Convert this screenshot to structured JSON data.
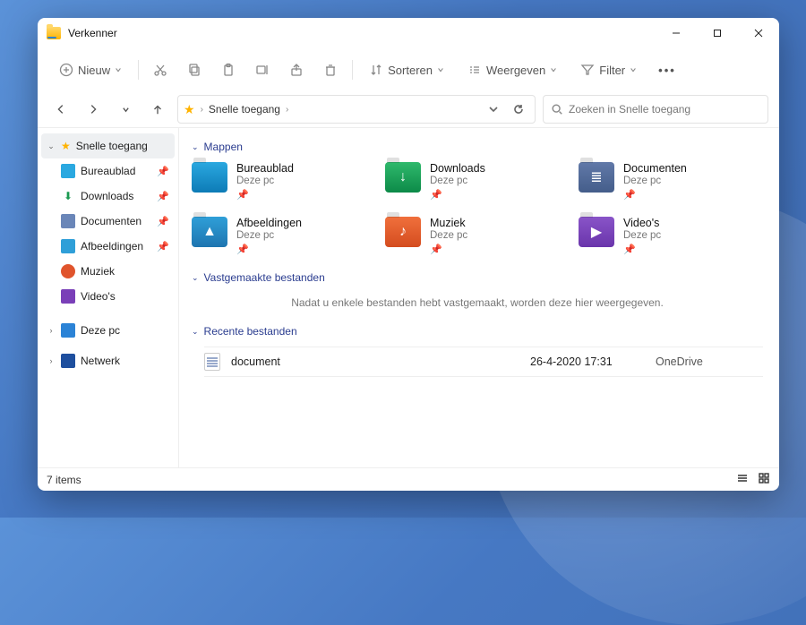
{
  "window": {
    "title": "Verkenner"
  },
  "toolbar": {
    "new": "Nieuw",
    "sort": "Sorteren",
    "view": "Weergeven",
    "filter": "Filter"
  },
  "address": {
    "location": "Snelle toegang"
  },
  "search": {
    "placeholder": "Zoeken in Snelle toegang"
  },
  "sidebar": {
    "quick": "Snelle toegang",
    "items": [
      {
        "label": "Bureaublad"
      },
      {
        "label": "Downloads"
      },
      {
        "label": "Documenten"
      },
      {
        "label": "Afbeeldingen"
      },
      {
        "label": "Muziek"
      },
      {
        "label": "Video's"
      }
    ],
    "thispc": "Deze pc",
    "network": "Netwerk"
  },
  "sections": {
    "folders": "Mappen",
    "pinned": "Vastgemaakte bestanden",
    "recent": "Recente bestanden"
  },
  "folders": [
    {
      "name": "Bureaublad",
      "sub": "Deze pc",
      "color": "blue",
      "glyph": ""
    },
    {
      "name": "Downloads",
      "sub": "Deze pc",
      "color": "green",
      "glyph": "↓"
    },
    {
      "name": "Documenten",
      "sub": "Deze pc",
      "color": "navy",
      "glyph": "≣"
    },
    {
      "name": "Afbeeldingen",
      "sub": "Deze pc",
      "color": "cyan",
      "glyph": "▲"
    },
    {
      "name": "Muziek",
      "sub": "Deze pc",
      "color": "orange",
      "glyph": "♪"
    },
    {
      "name": "Video's",
      "sub": "Deze pc",
      "color": "purple",
      "glyph": "▶"
    }
  ],
  "pinned_empty": "Nadat u enkele bestanden hebt vastgemaakt, worden deze hier weergegeven.",
  "recent": [
    {
      "name": "document",
      "date": "26-4-2020 17:31",
      "location": "OneDrive"
    }
  ],
  "status": {
    "count": "7 items"
  }
}
